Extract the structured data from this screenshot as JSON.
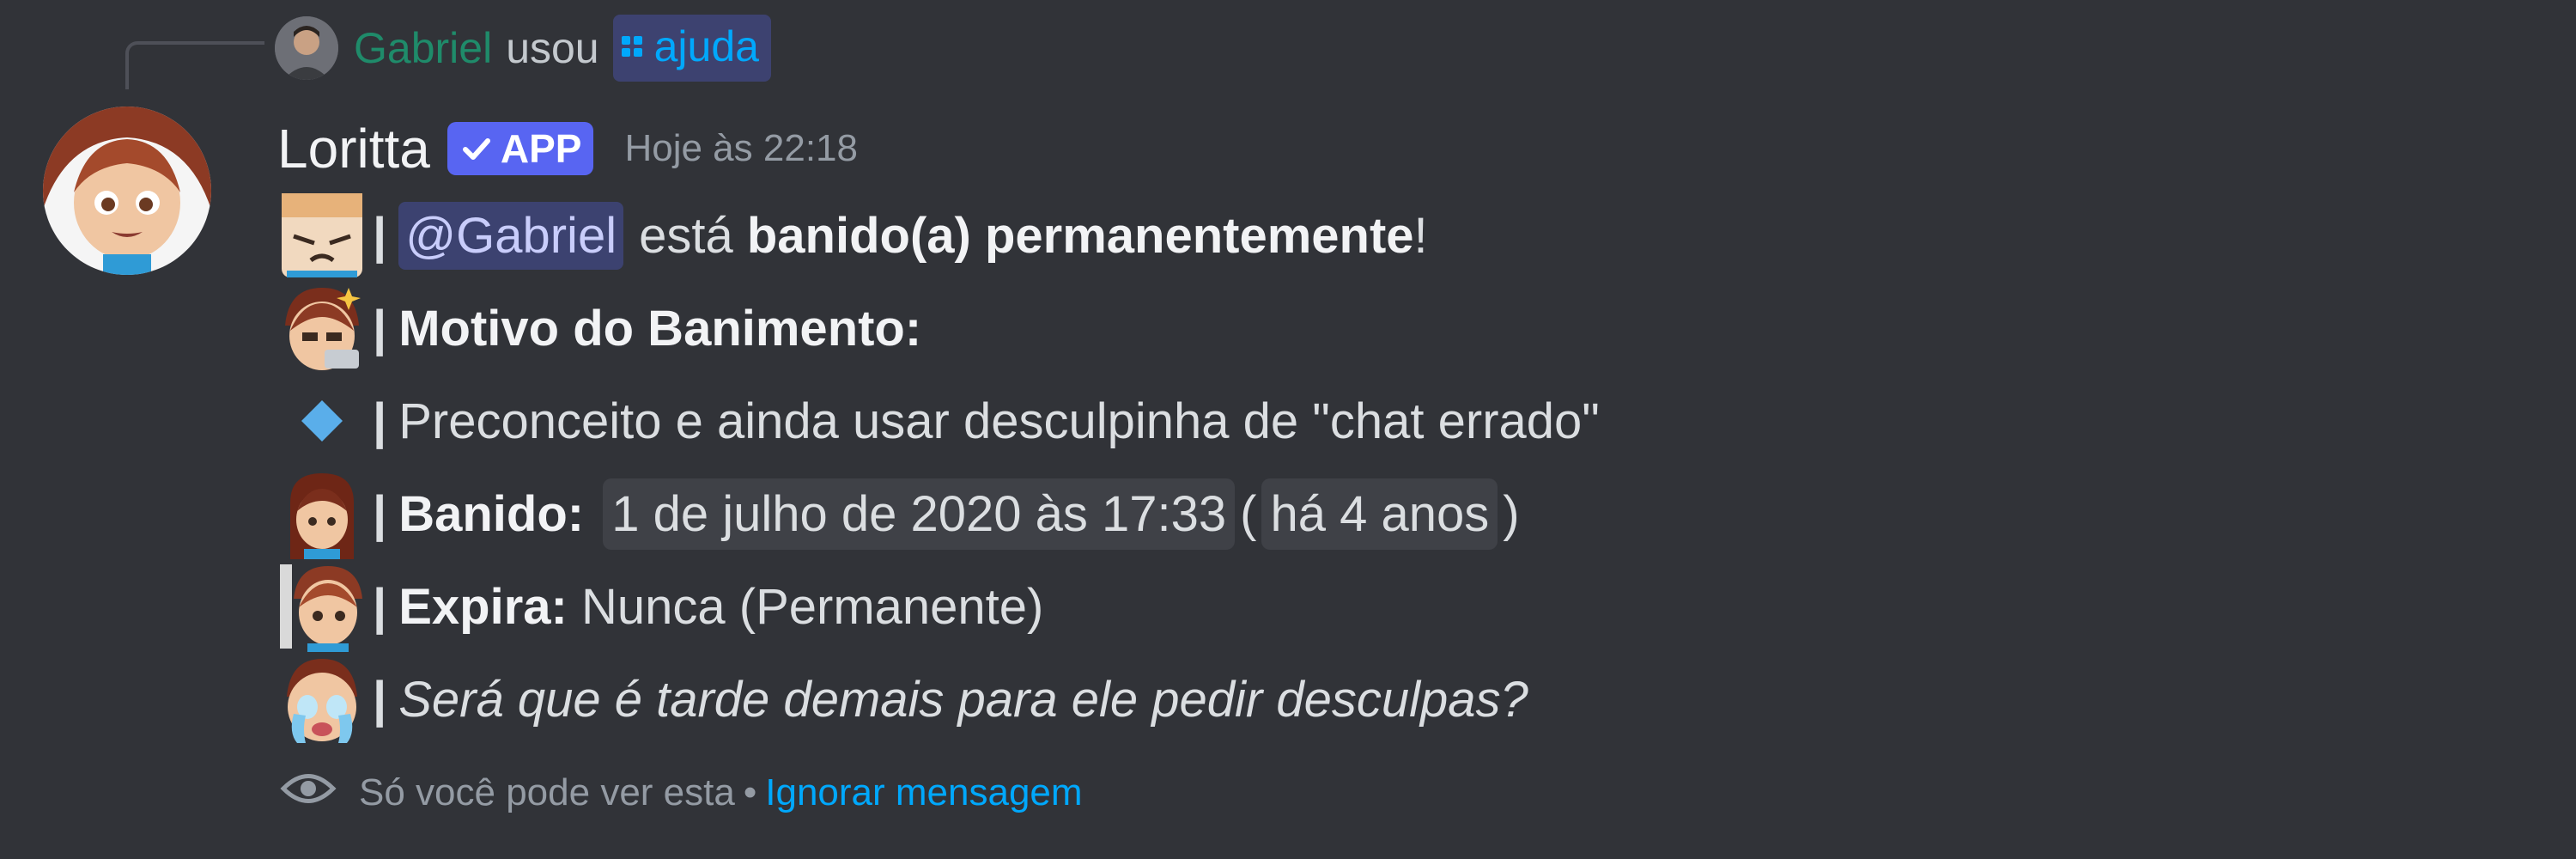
{
  "reply": {
    "user_name": "Gabriel",
    "used_text": "usou",
    "command_name": "ajuda",
    "avatar_icon": "user-avatar",
    "command_icon": "slash-command-icon"
  },
  "message": {
    "author": "Loritta",
    "app_badge": "APP",
    "timestamp": "Hoje às 22:18",
    "avatar_icon": "loritta-avatar"
  },
  "lines": {
    "l1": {
      "mention": "@Gabriel",
      "text_a": "está",
      "bold": "banido(a) permanentemente",
      "text_b": "!"
    },
    "l2": {
      "bold": "Motivo do Banimento:"
    },
    "l3": {
      "text": "Preconceito e ainda usar desculpinha de \"chat errado\""
    },
    "l4": {
      "bold": "Banido:",
      "date": "1 de julho de 2020 às 17:33",
      "paren_open": "(",
      "relative": "há 4 anos",
      "paren_close": ")"
    },
    "l5": {
      "bold": "Expira:",
      "text": "Nunca (Permanente)"
    },
    "l6": {
      "italic": "Será que é tarde demais para ele pedir desculpas?"
    }
  },
  "separator": "|",
  "footer": {
    "only_you": "Só você pode ver esta",
    "dot": "•",
    "dismiss": "Ignorar mensagem"
  },
  "colors": {
    "background": "#313338",
    "link": "#00a8fc",
    "app_badge": "#5865f2",
    "reply_name": "#1f8b6a",
    "diamond": "#5aaeea"
  }
}
